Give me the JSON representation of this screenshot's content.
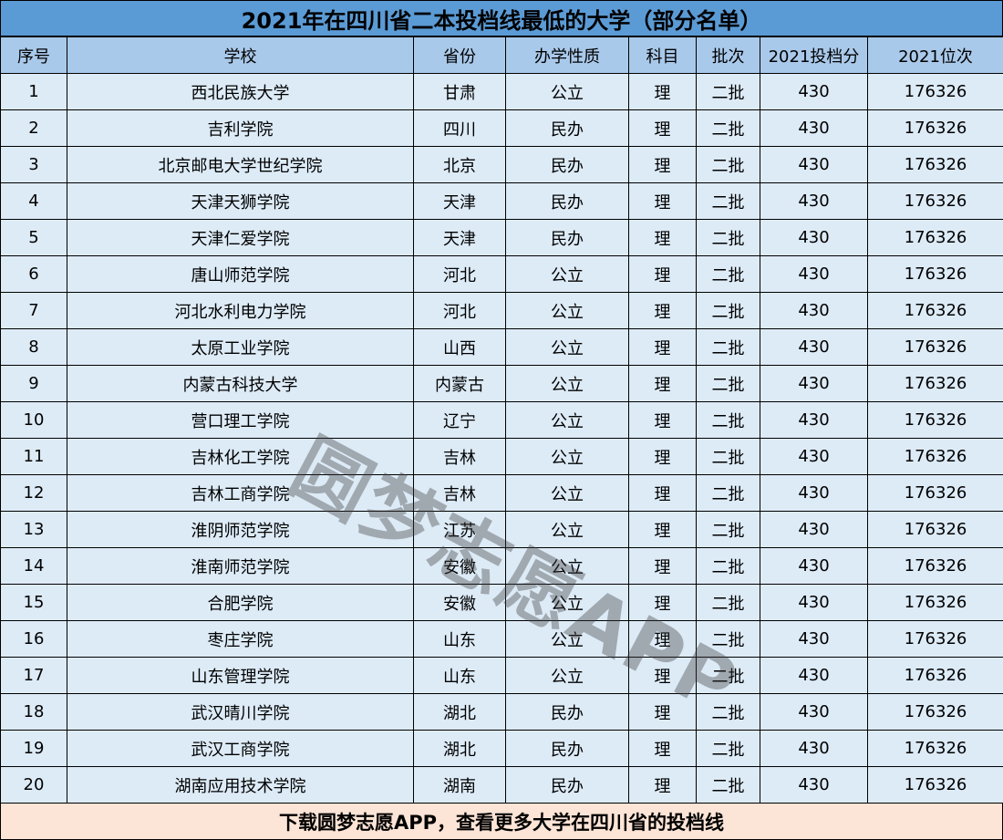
{
  "title": "2021年在四川省二本投档线最低的大学（部分名单）",
  "columns": [
    "序号",
    "学校",
    "省份",
    "办学性质",
    "科目",
    "批次",
    "2021投档分",
    "2021位次"
  ],
  "rows": [
    [
      "1",
      "西北民族大学",
      "甘肃",
      "公立",
      "理",
      "二批",
      "430",
      "176326"
    ],
    [
      "2",
      "吉利学院",
      "四川",
      "民办",
      "理",
      "二批",
      "430",
      "176326"
    ],
    [
      "3",
      "北京邮电大学世纪学院",
      "北京",
      "民办",
      "理",
      "二批",
      "430",
      "176326"
    ],
    [
      "4",
      "天津天狮学院",
      "天津",
      "民办",
      "理",
      "二批",
      "430",
      "176326"
    ],
    [
      "5",
      "天津仁爱学院",
      "天津",
      "民办",
      "理",
      "二批",
      "430",
      "176326"
    ],
    [
      "6",
      "唐山师范学院",
      "河北",
      "公立",
      "理",
      "二批",
      "430",
      "176326"
    ],
    [
      "7",
      "河北水利电力学院",
      "河北",
      "公立",
      "理",
      "二批",
      "430",
      "176326"
    ],
    [
      "8",
      "太原工业学院",
      "山西",
      "公立",
      "理",
      "二批",
      "430",
      "176326"
    ],
    [
      "9",
      "内蒙古科技大学",
      "内蒙古",
      "公立",
      "理",
      "二批",
      "430",
      "176326"
    ],
    [
      "10",
      "营口理工学院",
      "辽宁",
      "公立",
      "理",
      "二批",
      "430",
      "176326"
    ],
    [
      "11",
      "吉林化工学院",
      "吉林",
      "公立",
      "理",
      "二批",
      "430",
      "176326"
    ],
    [
      "12",
      "吉林工商学院",
      "吉林",
      "公立",
      "理",
      "二批",
      "430",
      "176326"
    ],
    [
      "13",
      "淮阴师范学院",
      "江苏",
      "公立",
      "理",
      "二批",
      "430",
      "176326"
    ],
    [
      "14",
      "淮南师范学院",
      "安徽",
      "公立",
      "理",
      "二批",
      "430",
      "176326"
    ],
    [
      "15",
      "合肥学院",
      "安徽",
      "公立",
      "理",
      "二批",
      "430",
      "176326"
    ],
    [
      "16",
      "枣庄学院",
      "山东",
      "公立",
      "理",
      "二批",
      "430",
      "176326"
    ],
    [
      "17",
      "山东管理学院",
      "山东",
      "公立",
      "理",
      "二批",
      "430",
      "176326"
    ],
    [
      "18",
      "武汉晴川学院",
      "湖北",
      "民办",
      "理",
      "二批",
      "430",
      "176326"
    ],
    [
      "19",
      "武汉工商学院",
      "湖北",
      "民办",
      "理",
      "二批",
      "430",
      "176326"
    ],
    [
      "20",
      "湖南应用技术学院",
      "湖南",
      "民办",
      "理",
      "二批",
      "430",
      "176326"
    ]
  ],
  "footer": "下载圆梦志愿APP，查看更多大学在四川省的投档线",
  "watermark": "圆梦志愿APP",
  "colors": {
    "title_bg": "#5b9bd5",
    "header_bg": "#a9c9ea",
    "row_bg": "#ddebf7",
    "footer_bg": "#fce4d6"
  }
}
